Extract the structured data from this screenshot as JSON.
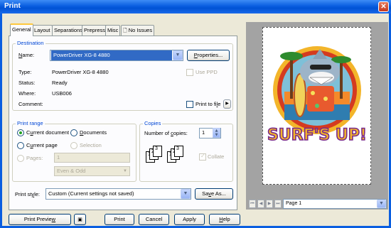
{
  "window": {
    "title": "Print"
  },
  "tabs": [
    "General",
    "Layout",
    "Separations",
    "Prepress",
    "Misc",
    "No Issues"
  ],
  "destination": {
    "group_title": "Destination",
    "name_label": "Name:",
    "name_value": "PowerDriver XG-8 4880",
    "properties_button": "Properties...",
    "type_label": "Type:",
    "type_value": "PowerDriver XG-8 4880",
    "use_ppd_label": "Use PPD",
    "status_label": "Status:",
    "status_value": "Ready",
    "where_label": "Where:",
    "where_value": "USB006",
    "comment_label": "Comment:",
    "print_to_file_label": "Print to file"
  },
  "print_range": {
    "group_title": "Print range",
    "current_document": "Current document",
    "documents": "Documents",
    "current_page": "Current page",
    "selection": "Selection",
    "pages_label": "Pages:",
    "pages_value": "1",
    "even_odd_value": "Even & Odd"
  },
  "copies": {
    "group_title": "Copies",
    "number_label": "Number of copies:",
    "number_value": "1",
    "collate_label": "Collate",
    "icon_pages": [
      "1",
      "2",
      "3",
      "1",
      "2",
      "3"
    ]
  },
  "print_style": {
    "label": "Print style:",
    "value": "Custom (Current settings not saved)",
    "save_as_button": "Save As..."
  },
  "buttons": {
    "print_preview": "Print Preview",
    "print": "Print",
    "cancel": "Cancel",
    "apply": "Apply",
    "help": "Help"
  },
  "preview": {
    "page_value": "Page 1",
    "artwork_text": "SURF'S UP!"
  },
  "colors": {
    "title_bar": "#0a5ee0",
    "group_title": "#0046d5",
    "selection": "#316ac5",
    "window_bg": "#ece9d8"
  }
}
